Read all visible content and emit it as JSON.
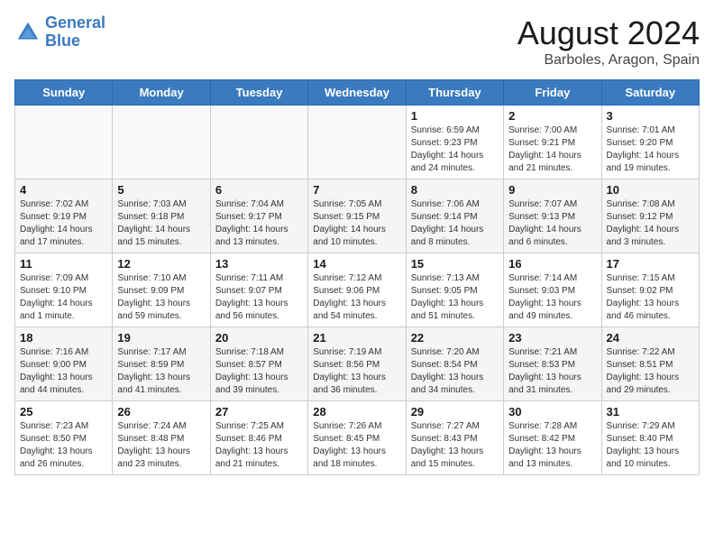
{
  "header": {
    "logo_line1": "General",
    "logo_line2": "Blue",
    "main_title": "August 2024",
    "subtitle": "Barboles, Aragon, Spain"
  },
  "weekdays": [
    "Sunday",
    "Monday",
    "Tuesday",
    "Wednesday",
    "Thursday",
    "Friday",
    "Saturday"
  ],
  "weeks": [
    [
      {
        "day": "",
        "info": ""
      },
      {
        "day": "",
        "info": ""
      },
      {
        "day": "",
        "info": ""
      },
      {
        "day": "",
        "info": ""
      },
      {
        "day": "1",
        "info": "Sunrise: 6:59 AM\nSunset: 9:23 PM\nDaylight: 14 hours\nand 24 minutes."
      },
      {
        "day": "2",
        "info": "Sunrise: 7:00 AM\nSunset: 9:21 PM\nDaylight: 14 hours\nand 21 minutes."
      },
      {
        "day": "3",
        "info": "Sunrise: 7:01 AM\nSunset: 9:20 PM\nDaylight: 14 hours\nand 19 minutes."
      }
    ],
    [
      {
        "day": "4",
        "info": "Sunrise: 7:02 AM\nSunset: 9:19 PM\nDaylight: 14 hours\nand 17 minutes."
      },
      {
        "day": "5",
        "info": "Sunrise: 7:03 AM\nSunset: 9:18 PM\nDaylight: 14 hours\nand 15 minutes."
      },
      {
        "day": "6",
        "info": "Sunrise: 7:04 AM\nSunset: 9:17 PM\nDaylight: 14 hours\nand 13 minutes."
      },
      {
        "day": "7",
        "info": "Sunrise: 7:05 AM\nSunset: 9:15 PM\nDaylight: 14 hours\nand 10 minutes."
      },
      {
        "day": "8",
        "info": "Sunrise: 7:06 AM\nSunset: 9:14 PM\nDaylight: 14 hours\nand 8 minutes."
      },
      {
        "day": "9",
        "info": "Sunrise: 7:07 AM\nSunset: 9:13 PM\nDaylight: 14 hours\nand 6 minutes."
      },
      {
        "day": "10",
        "info": "Sunrise: 7:08 AM\nSunset: 9:12 PM\nDaylight: 14 hours\nand 3 minutes."
      }
    ],
    [
      {
        "day": "11",
        "info": "Sunrise: 7:09 AM\nSunset: 9:10 PM\nDaylight: 14 hours\nand 1 minute."
      },
      {
        "day": "12",
        "info": "Sunrise: 7:10 AM\nSunset: 9:09 PM\nDaylight: 13 hours\nand 59 minutes."
      },
      {
        "day": "13",
        "info": "Sunrise: 7:11 AM\nSunset: 9:07 PM\nDaylight: 13 hours\nand 56 minutes."
      },
      {
        "day": "14",
        "info": "Sunrise: 7:12 AM\nSunset: 9:06 PM\nDaylight: 13 hours\nand 54 minutes."
      },
      {
        "day": "15",
        "info": "Sunrise: 7:13 AM\nSunset: 9:05 PM\nDaylight: 13 hours\nand 51 minutes."
      },
      {
        "day": "16",
        "info": "Sunrise: 7:14 AM\nSunset: 9:03 PM\nDaylight: 13 hours\nand 49 minutes."
      },
      {
        "day": "17",
        "info": "Sunrise: 7:15 AM\nSunset: 9:02 PM\nDaylight: 13 hours\nand 46 minutes."
      }
    ],
    [
      {
        "day": "18",
        "info": "Sunrise: 7:16 AM\nSunset: 9:00 PM\nDaylight: 13 hours\nand 44 minutes."
      },
      {
        "day": "19",
        "info": "Sunrise: 7:17 AM\nSunset: 8:59 PM\nDaylight: 13 hours\nand 41 minutes."
      },
      {
        "day": "20",
        "info": "Sunrise: 7:18 AM\nSunset: 8:57 PM\nDaylight: 13 hours\nand 39 minutes."
      },
      {
        "day": "21",
        "info": "Sunrise: 7:19 AM\nSunset: 8:56 PM\nDaylight: 13 hours\nand 36 minutes."
      },
      {
        "day": "22",
        "info": "Sunrise: 7:20 AM\nSunset: 8:54 PM\nDaylight: 13 hours\nand 34 minutes."
      },
      {
        "day": "23",
        "info": "Sunrise: 7:21 AM\nSunset: 8:53 PM\nDaylight: 13 hours\nand 31 minutes."
      },
      {
        "day": "24",
        "info": "Sunrise: 7:22 AM\nSunset: 8:51 PM\nDaylight: 13 hours\nand 29 minutes."
      }
    ],
    [
      {
        "day": "25",
        "info": "Sunrise: 7:23 AM\nSunset: 8:50 PM\nDaylight: 13 hours\nand 26 minutes."
      },
      {
        "day": "26",
        "info": "Sunrise: 7:24 AM\nSunset: 8:48 PM\nDaylight: 13 hours\nand 23 minutes."
      },
      {
        "day": "27",
        "info": "Sunrise: 7:25 AM\nSunset: 8:46 PM\nDaylight: 13 hours\nand 21 minutes."
      },
      {
        "day": "28",
        "info": "Sunrise: 7:26 AM\nSunset: 8:45 PM\nDaylight: 13 hours\nand 18 minutes."
      },
      {
        "day": "29",
        "info": "Sunrise: 7:27 AM\nSunset: 8:43 PM\nDaylight: 13 hours\nand 15 minutes."
      },
      {
        "day": "30",
        "info": "Sunrise: 7:28 AM\nSunset: 8:42 PM\nDaylight: 13 hours\nand 13 minutes."
      },
      {
        "day": "31",
        "info": "Sunrise: 7:29 AM\nSunset: 8:40 PM\nDaylight: 13 hours\nand 10 minutes."
      }
    ]
  ]
}
